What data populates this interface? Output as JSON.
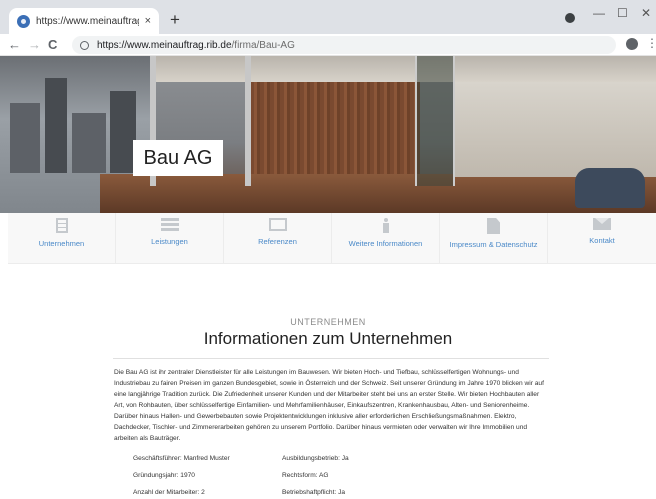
{
  "browser": {
    "tab_title": "https://www.meinauftrag.rib.de/fi",
    "tab_close": "×",
    "new_tab": "+",
    "url_host": "https://www.meinauftrag.rib.de",
    "url_path": "/firma/Bau-AG",
    "back": "←",
    "forward": "→",
    "reload": "C",
    "minimize": "—",
    "maximize": "☐",
    "close": "✕",
    "menu": "⋮"
  },
  "hero": {
    "company_name": "Bau AG"
  },
  "section_nav": {
    "items": [
      {
        "label": "Unternehmen",
        "icon": "building-icon"
      },
      {
        "label": "Leistungen",
        "icon": "list-icon"
      },
      {
        "label": "Referenzen",
        "icon": "image-icon"
      },
      {
        "label": "Weitere Informationen",
        "icon": "info-icon"
      },
      {
        "label": "Impressum & Datenschutz",
        "icon": "document-icon"
      },
      {
        "label": "Kontakt",
        "icon": "mail-icon"
      }
    ],
    "accent_color": "#4a89c8"
  },
  "content": {
    "kicker": "UNTERNEHMEN",
    "heading": "Informationen zum Unternehmen",
    "description": "Die Bau AG ist ihr zentraler Dienstleister für alle Leistungen im Bauwesen. Wir bieten Hoch- und Tiefbau, schlüsselfertigen Wohnungs- und Industriebau zu fairen Preisen im ganzen Bundesgebiet, sowie in Österreich und der Schweiz. Seit unserer Gründung im Jahre 1970 blicken wir auf eine langjährige Tradition zurück. Die Zufriedenheit unserer Kunden und der Mitarbeiter steht bei uns an erster Stelle. Wir bieten Hochbauten aller Art, von Rohbauten, über schlüsselfertige Einfamilien- und Mehrfamilienhäuser, Einkaufszentren, Krankenhausbau, Alten- und Seniorenheime. Darüber hinaus Hallen- und Gewerbebauten sowie Projektentwicklungen inklusive aller erforderlichen Erschließungsmaßnahmen. Elektro, Dachdecker, Tischler- und Zimmererarbeiten gehören zu unserem Portfolio. Darüber hinaus vermieten oder verwalten wir Ihre Immobilien und arbeiten als Bauträger.",
    "facts": {
      "ceo": "Geschäftsführer: Manfred Muster",
      "training": "Ausbildungsbetrieb: Ja",
      "founded": "Gründungsjahr: 1970",
      "legal_form": "Rechtsform: AG",
      "employees": "Anzahl der Mitarbeiter: 2",
      "liability_insurance": "Betriebshaftpflicht: Ja"
    }
  }
}
